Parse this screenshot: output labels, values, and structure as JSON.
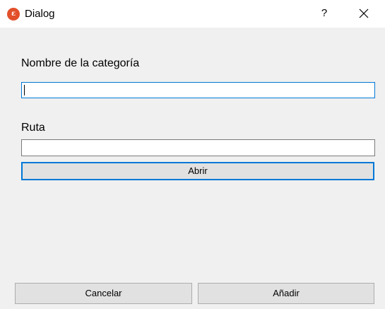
{
  "window": {
    "title": "Dialog",
    "app_icon_glyph": "ε",
    "help_label": "?"
  },
  "form": {
    "category_label": "Nombre de la categoría",
    "category_value": "",
    "path_label": "Ruta",
    "path_value": "",
    "open_button": "Abrir"
  },
  "footer": {
    "cancel_button": "Cancelar",
    "add_button": "Añadir"
  },
  "colors": {
    "focus_accent": "#0078d7",
    "app_icon": "#e2502a",
    "window_bg": "#f0f0f0",
    "button_bg": "#e1e1e1"
  },
  "icons": [
    "app-icon",
    "help-icon",
    "close-icon"
  ]
}
